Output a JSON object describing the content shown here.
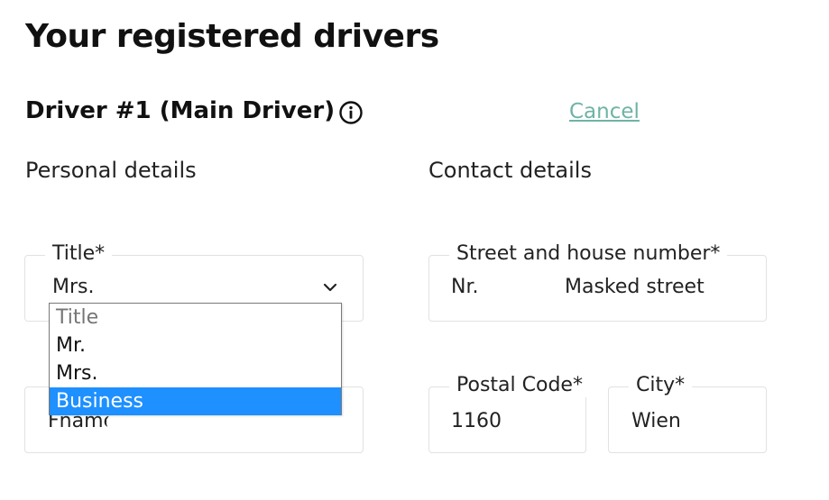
{
  "page": {
    "title": "Your registered drivers"
  },
  "driver": {
    "heading": "Driver #1  (Main Driver)",
    "cancel_label": "Cancel"
  },
  "sections": {
    "personal": "Personal details",
    "contact": "Contact details"
  },
  "personal": {
    "title_field": {
      "label": "Title*",
      "value": "Mrs.",
      "options": [
        "Title",
        "Mr.",
        "Mrs.",
        "Business"
      ],
      "highlighted_option": "Business"
    },
    "first_name_field": {
      "value": "Fname_"
    }
  },
  "contact": {
    "street_field": {
      "label": "Street and house number*",
      "number_value": "Nr.",
      "street_value": "Masked street"
    },
    "postal_field": {
      "label": "Postal Code*",
      "value": "1160"
    },
    "city_field": {
      "label": "City*",
      "value": "Wien"
    }
  },
  "colors": {
    "cancel_link": "#6fb3a6",
    "highlight": "#1e90ff",
    "border": "#e2e2e2"
  },
  "icons": {
    "info": "info-circle-icon",
    "dropdown": "chevron-down-icon"
  }
}
